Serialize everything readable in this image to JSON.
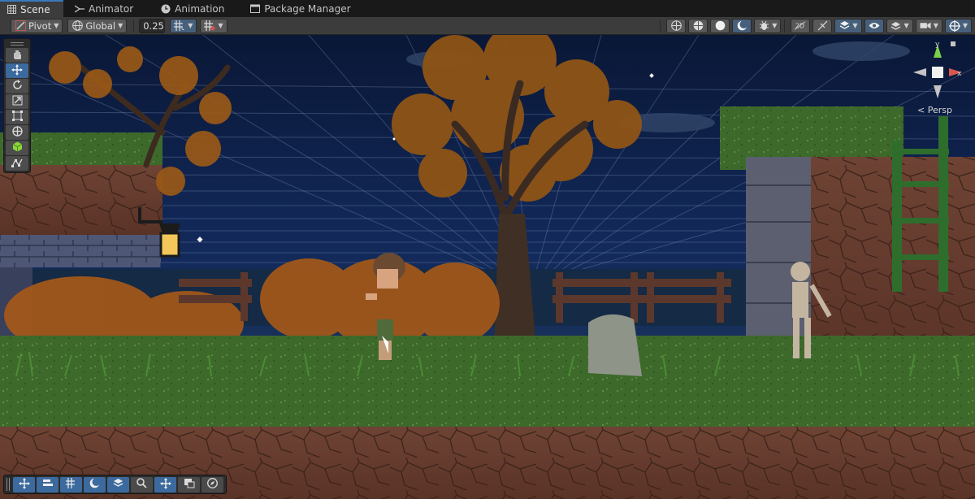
{
  "tabs": [
    {
      "label": "Scene",
      "icon": "grid-icon",
      "active": true
    },
    {
      "label": "Animator",
      "icon": "animator-icon",
      "active": false
    },
    {
      "label": "Animation",
      "icon": "clock-icon",
      "active": false
    },
    {
      "label": "Package Manager",
      "icon": "package-icon",
      "active": false
    }
  ],
  "toolbar": {
    "pivot_label": "Pivot",
    "global_label": "Global",
    "snap_value": "0.25"
  },
  "scene": {
    "persp_label": "Persp",
    "gizmo_axis_x": "x",
    "gizmo_axis_y": "y"
  },
  "colors": {
    "accent": "#3d6a9e",
    "sky_top": "#0b1838",
    "grass": "#3d6b2a",
    "dirt": "#6b3f31"
  }
}
